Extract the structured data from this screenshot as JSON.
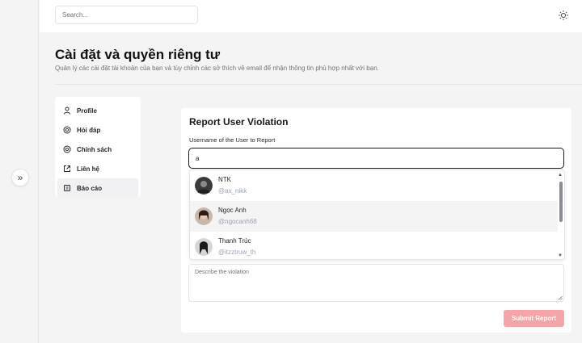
{
  "search": {
    "placeholder": "Search..."
  },
  "header": {
    "title": "Cài đặt và quyền riêng tư",
    "subtitle": "Quản lý các cài đặt tài khoản của bạn và tùy chỉnh các sở thích về email để nhận thông tin phù hợp nhất với bạn."
  },
  "sidebar": {
    "items": [
      {
        "label": "Profile",
        "icon": "user-icon"
      },
      {
        "label": "Hỏi đáp",
        "icon": "help-icon"
      },
      {
        "label": "Chính sách",
        "icon": "policy-icon"
      },
      {
        "label": "Liên hệ",
        "icon": "contact-icon"
      },
      {
        "label": "Báo cáo",
        "icon": "report-icon",
        "active": true
      }
    ]
  },
  "report": {
    "title": "Report User Violation",
    "username_label": "Username of the User to Report",
    "username_value": "a",
    "suggestions": [
      {
        "name": "NTK",
        "handle": "@ax_nikk"
      },
      {
        "name": "Ngọc Anh",
        "handle": "@ngocanh68"
      },
      {
        "name": "Thanh Trúc",
        "handle": "@itzztruw_th"
      }
    ],
    "description_placeholder": "Describe the violation",
    "submit_label": "Submit Report"
  },
  "colors": {
    "submit_bg": "#f5a5a7",
    "active_nav_bg": "#f1f1f3"
  }
}
